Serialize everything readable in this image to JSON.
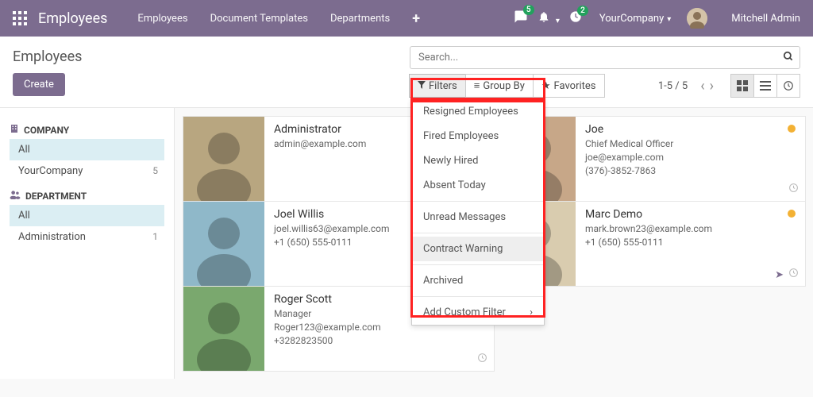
{
  "nav": {
    "brand": "Employees",
    "links": [
      "Employees",
      "Document Templates",
      "Departments"
    ],
    "msg_badge": "5",
    "activity_badge": "2",
    "company": "YourCompany",
    "user_name": "Mitchell Admin"
  },
  "page": {
    "title": "Employees",
    "create": "Create",
    "search_placeholder": "Search...",
    "filters_label": "Filters",
    "groupby_label": "Group By",
    "favorites_label": "Favorites",
    "pager": "1-5 / 5"
  },
  "sidebar": {
    "company_header": "COMPANY",
    "company_items": [
      {
        "label": "All",
        "count": "",
        "selected": true
      },
      {
        "label": "YourCompany",
        "count": "5",
        "selected": false
      }
    ],
    "dept_header": "DEPARTMENT",
    "dept_items": [
      {
        "label": "All",
        "count": "",
        "selected": true
      },
      {
        "label": "Administration",
        "count": "1",
        "selected": false
      }
    ]
  },
  "filter_menu": {
    "items": [
      "Resigned Employees",
      "Fired Employees",
      "Newly Hired",
      "Absent Today"
    ],
    "items2": [
      "Unread Messages"
    ],
    "items3": [
      "Contract Warning"
    ],
    "items4": [
      "Archived"
    ],
    "custom": "Add Custom Filter"
  },
  "cards": [
    {
      "name": "Administrator",
      "title": "",
      "email": "admin@example.com",
      "phone": "",
      "dot": false,
      "bg": "#b8a680"
    },
    {
      "name": "Joe",
      "title": "Chief Medical Officer",
      "email": "joe@example.com",
      "phone": "(376)-3852-7863",
      "dot": true,
      "bg": "#c7a788"
    },
    {
      "name": "Joel Willis",
      "title": "",
      "email": "joel.willis63@example.com",
      "phone": "+1 (650) 555-0111",
      "dot": false,
      "bg": "#8fb8c9"
    },
    {
      "name": "Marc Demo",
      "title": "",
      "email": "mark.brown23@example.com",
      "phone": "+1 (650) 555-0111",
      "dot": true,
      "bg": "#d9ccaf",
      "chat": true
    },
    {
      "name": "Roger Scott",
      "title": "Manager",
      "email": "Roger123@example.com",
      "phone": "+3282823500",
      "dot": false,
      "bg": "#7aa86e"
    }
  ]
}
